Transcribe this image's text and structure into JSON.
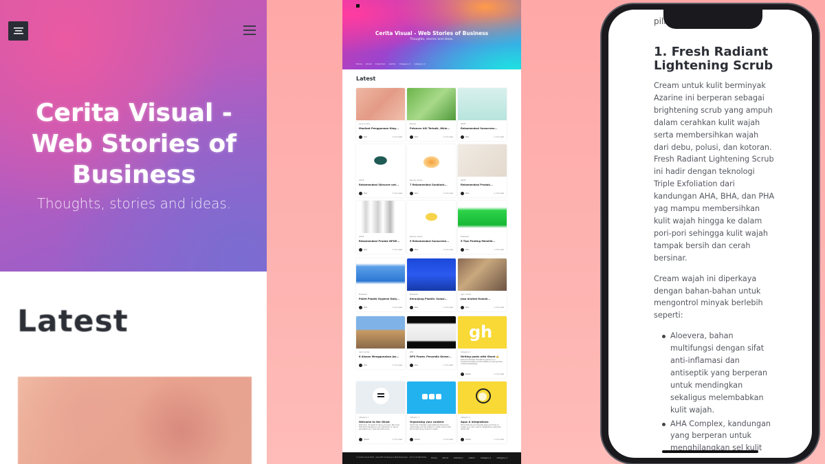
{
  "left": {
    "site_title": "Cerita Visual - Web Stories of Business",
    "description": "Thoughts, stories and ideas.",
    "latest_heading": "Latest"
  },
  "center": {
    "site_title": "Cerita Visual - Web Stories of Business",
    "description": "Thoughts, stories and ideas.",
    "nav": [
      "Home",
      "About",
      "Collection",
      "Author",
      "Category 1",
      "Category 2"
    ],
    "latest_heading": "Latest",
    "cards": [
      {
        "tag": "Acne & Care",
        "title": "Manfaat Penggunaan Hing...",
        "excerpt": "",
        "author": "Dini",
        "read": "1 min read",
        "img": "skin"
      },
      {
        "tag": "Beauty",
        "title": "Pelancar ASI Terbaik, Wkin...",
        "excerpt": "",
        "author": "Dini",
        "read": "1 min read",
        "img": "green"
      },
      {
        "tag": "WAVE",
        "title": "Rekomendasi Sunscreen...",
        "excerpt": "",
        "author": "Dini",
        "read": "1 min read",
        "img": "mint"
      },
      {
        "tag": "WAVE",
        "title": "Rekomendasi Skincare unt...",
        "excerpt": "",
        "author": "Dini",
        "read": "1 min read",
        "img": "tube-dark"
      },
      {
        "tag": "Beauty Center",
        "title": "7 Rekomendasi Sunblock...",
        "excerpt": "",
        "author": "Dini",
        "read": "1 min read",
        "img": "tube-orange"
      },
      {
        "tag": "WAVE",
        "title": "Rekomendasi Produk...",
        "excerpt": "",
        "author": "Dini",
        "read": "1 min read",
        "img": "cream"
      },
      {
        "tag": "WAVE",
        "title": "Rekomendasi Produk NPUR...",
        "excerpt": "",
        "author": "Dini",
        "read": "1 min read",
        "img": "bottles"
      },
      {
        "tag": "Beauty Center",
        "title": "5 Rekomendasi Sunscreen...",
        "excerpt": "",
        "author": "Dini",
        "read": "1 min read",
        "img": "tube-yellow"
      },
      {
        "tag": "Makassar",
        "title": "5 Tips Penting Memilih...",
        "excerpt": "",
        "author": "Dini",
        "read": "1 min read",
        "img": "crate-green"
      },
      {
        "tag": "Makassar",
        "title": "Pallet Plastik Hygiene Duty...",
        "excerpt": "",
        "author": "Dini",
        "read": "1 min read",
        "img": "pallet"
      },
      {
        "tag": "Makassar",
        "title": "Keranjang Plastik: Solusi...",
        "excerpt": "",
        "author": "Dini",
        "read": "1 min read",
        "img": "basket"
      },
      {
        "tag": "Agro Center",
        "title": "Jasa Arsitek Rumah...",
        "excerpt": "",
        "author": "Dini",
        "read": "1 min read",
        "img": "people"
      },
      {
        "tag": "Agro Center",
        "title": "6 Alasan Menggunakan Jas...",
        "excerpt": "",
        "author": "Dini",
        "read": "1 min read",
        "img": "house"
      },
      {
        "tag": "DPS",
        "title": "DPS Power, Penyedia Gense...",
        "excerpt": "",
        "author": "Dini",
        "read": "1 min read",
        "img": "genset"
      },
      {
        "tag": "Category 2",
        "title": "Writing posts with Ghost ✍️",
        "excerpt": "Discover familiar formatting options in a functional toolbar and the ability to add dynamic content seamlessly.",
        "author": "Ghost",
        "read": "1 min read",
        "img": "gh"
      },
      {
        "tag": "Category 1",
        "title": "Welcome to the Ghost",
        "excerpt": "Welcome, it's great to have you here. We know that first impressions are important, so we've populated your new site with some...",
        "author": "Ghost",
        "read": "1 min read",
        "img": "ghost-logo"
      },
      {
        "tag": "Category 1",
        "title": "Organising your content",
        "excerpt": "Ghost has a flexible organisational taxonomy called tags and the ability to create custom site structures using dynamic routes.",
        "author": "Ghost",
        "read": "1 min read",
        "img": "blue-dots"
      },
      {
        "tag": "Category 2",
        "title": "Apps & integrations",
        "excerpt": "Work with all your favorite apps and tools or create your own custom integrations using the Ghost API.",
        "author": "Ghost",
        "read": "1 min read",
        "img": "yellow-circles"
      }
    ],
    "footer_copy": "© Cerita Visual 2022 · Jasa SEO Surabaya & Web Developer · 2nd to Ghrflab Buka",
    "footer_links": [
      "Home",
      "About",
      "Collection",
      "Author",
      "Category 1",
      "Category 2"
    ]
  },
  "phone": {
    "top_text": "pilihan.",
    "heading": "1. Fresh Radiant Lightening Scrub",
    "paragraphs": [
      "Cream untuk kulit berminyak Azarine ini berperan sebagai brightening scrub yang ampuh dalam cerahkan kulit wajah serta membersihkan wajah dari debu, polusi, dan kotoran. Fresh Radiant Lightening Scrub ini hadir dengan teknologi Triple Exfoliation dari kandungan AHA, BHA, dan PHA yag mampu membersihkan kulit wajah hingga ke dalam pori-pori sehingga kulit wajah tampak bersih dan cerah bersinar.",
      "Cream wajah ini diperkaya dengan bahan-bahan untuk mengontrol minyak berlebih seperti:"
    ],
    "bullets": [
      "Aloevera, bahan multifungsi dengan sifat anti-inflamasi dan antiseptik yang berperan untuk mendingkan sekaligus melembabkan kulit wajah.",
      "AHA Complex, kandungan yang berperan untuk menghilangkan sel kulit"
    ]
  }
}
